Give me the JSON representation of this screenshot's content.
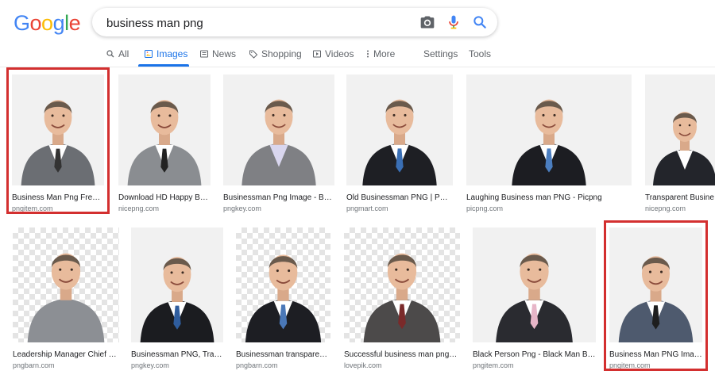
{
  "logo": {
    "letters": [
      "G",
      "o",
      "o",
      "g",
      "l",
      "e"
    ],
    "colors": [
      "#4285F4",
      "#EA4335",
      "#FBBC05",
      "#4285F4",
      "#34A853",
      "#EA4335"
    ]
  },
  "search": {
    "query": "business man png"
  },
  "tabs": [
    {
      "label": "All",
      "icon": "search-icon"
    },
    {
      "label": "Images",
      "icon": "image-icon",
      "active": true
    },
    {
      "label": "News",
      "icon": "news-icon"
    },
    {
      "label": "Shopping",
      "icon": "tag-icon"
    },
    {
      "label": "Videos",
      "icon": "play-icon"
    },
    {
      "label": "More",
      "icon": "more-vert-icon"
    }
  ],
  "tools": {
    "settings": "Settings",
    "tools": "Tools"
  },
  "results": [
    {
      "caption": "Business Man Png Fre…",
      "source": "pngitem.com",
      "suit": "#6b6e73",
      "shirt": "#ffffff",
      "tie": "#333333",
      "bg": "plain",
      "highlighted": true
    },
    {
      "caption": "Download HD Happy B…",
      "source": "nicepng.com",
      "suit": "#8a8d91",
      "shirt": "#ffffff",
      "tie": "#222222",
      "bg": "plain"
    },
    {
      "caption": "Businessman Png Image - B…",
      "source": "pngkey.com",
      "suit": "#7f8084",
      "shirt": "#d9d6ee",
      "tie": "none",
      "bg": "plain"
    },
    {
      "caption": "Old Businessman PNG | PN…",
      "source": "pngmart.com",
      "suit": "#1e1f24",
      "shirt": "#ffffff",
      "tie": "#3a6fb5",
      "bg": "plain"
    },
    {
      "caption": "Laughing Business man PNG - Picpng",
      "source": "picpng.com",
      "suit": "#1c1d22",
      "shirt": "#ffffff",
      "tie": "#4b7ec0",
      "bg": "plain"
    },
    {
      "caption": "Transparent Busine…",
      "source": "nicepng.com",
      "suit": "#23252b",
      "shirt": "#ffffff",
      "tie": "none",
      "bg": "plain"
    },
    {
      "caption": "Leadership Manager Chief …",
      "source": "pngbarn.com",
      "suit": "#8c8f94",
      "shirt": "#8c8f94",
      "tie": "none",
      "bg": "checker"
    },
    {
      "caption": "Businessman PNG, Tra…",
      "source": "pngkey.com",
      "suit": "#1b1c20",
      "shirt": "#ffffff",
      "tie": "#2f5d9e",
      "bg": "plain"
    },
    {
      "caption": "Businessman transpare…",
      "source": "pngbarn.com",
      "suit": "#1d1e23",
      "shirt": "#ffffff",
      "tie": "#4a78b8",
      "bg": "checker"
    },
    {
      "caption": "Successful business man png…",
      "source": "lovepik.com",
      "suit": "#4c4a4a",
      "shirt": "#ffffff",
      "tie": "#7a2a2a",
      "bg": "checker"
    },
    {
      "caption": "Black Person Png - Black Man B…",
      "source": "pngitem.com",
      "suit": "#2a2b30",
      "shirt": "#ffffff",
      "tie": "#e7b6c8",
      "bg": "plain"
    },
    {
      "caption": "Business Man PNG Ima…",
      "source": "pngitem.com",
      "suit": "#4e5a6e",
      "shirt": "#ffffff",
      "tie": "#1e1e1e",
      "bg": "plain",
      "highlighted": true
    }
  ]
}
